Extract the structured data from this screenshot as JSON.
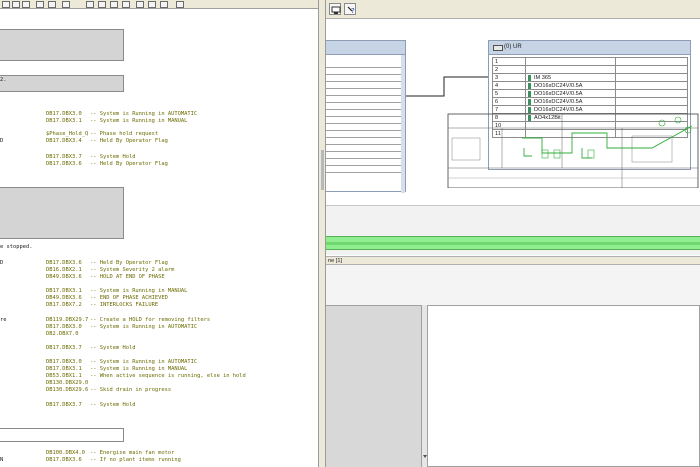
{
  "left_editor": {
    "comment_lines": [
      "-- System is Running in AUTOMATIC",
      "-- System is Running in MANUAL",
      "-- Phase hold request",
      "-- Held By Operator Flag",
      "-- System Hold",
      "-- Held By Operator Flag",
      "-- Held By Operator Flag",
      "-- System Severity 2 alarm",
      "-- HOLD AT END OF PHASE",
      "-- System is Running in MANUAL",
      "-- END OF PHASE ACHIEVED",
      "-- INTERLOCKS FAILURE",
      "-- Create a HOLD for removing filters",
      "-- System is Running in AUTOMATIC",
      "-- System Hold",
      "-- System is Running in AUTOMATIC",
      "-- System is Running in MANUAL",
      "-- When active sequence is running, else in hold",
      "-- Skid drain in progress",
      "-- System Hold",
      "-- Energise main fan motor",
      "-- If no plant items running"
    ],
    "address_lines": [
      "DB17.DBX3.0",
      "DB17.DBX3.1",
      "$Phase_Hold_Q",
      "DB17.DBX3.4",
      "DB17.DBX3.7",
      "DB17.DBX3.6",
      "DB17.DBX3.6",
      "DB16.DBX2.1",
      "DB49.DBX3.6",
      "DB17.DBX3.1",
      "DB49.DBX3.6",
      "DB17.DBX7.2",
      "DB119.DBX29.7",
      "DB17.DBX3.0",
      "DB2.DBX7.0",
      "DB17.DBX3.7",
      "DB17.DBX3.0",
      "DB17.DBX3.1",
      "DB53.DBX1.1",
      "DB130.DBX29.0",
      "DB130.DBX29.6",
      "DB17.DBX3.7",
      "DB100.DBX4.0",
      "DB17.DBX3.6"
    ],
    "stmt_fragments": {
      "s1": "D",
      "s2": "D",
      "s3": "e stopped.",
      "s4": "D",
      "s5": "re",
      "s6": "N",
      "header_fragment": "2."
    }
  },
  "hw_config": {
    "pane_header": "ne [1]",
    "rack": {
      "name": "(0) UR",
      "rows": [
        {
          "slot": "1",
          "module": ""
        },
        {
          "slot": "2",
          "module": ""
        },
        {
          "slot": "3",
          "module": "IM 365"
        },
        {
          "slot": "4",
          "module": "DO16xDC24V/0.5A"
        },
        {
          "slot": "5",
          "module": "DO16xDC24V/0.5A"
        },
        {
          "slot": "6",
          "module": "DO16xDC24V/0.5A"
        },
        {
          "slot": "7",
          "module": "DO16xDC24V/0.5A"
        },
        {
          "slot": "8",
          "module": "AO4x12Bit"
        },
        {
          "slot": "10",
          "module": ""
        },
        {
          "slot": "11",
          "module": ""
        }
      ]
    }
  },
  "icons": {
    "toolbar_left": [
      "cut-icon",
      "copy-icon",
      "paste-icon",
      "find-icon"
    ],
    "toolbar_right": [
      "station-icon",
      "help-icon"
    ]
  },
  "colors": {
    "green_bar": "#90ee90",
    "rack_title": "#c6d4e6",
    "comment_text": "#6b6b00"
  }
}
